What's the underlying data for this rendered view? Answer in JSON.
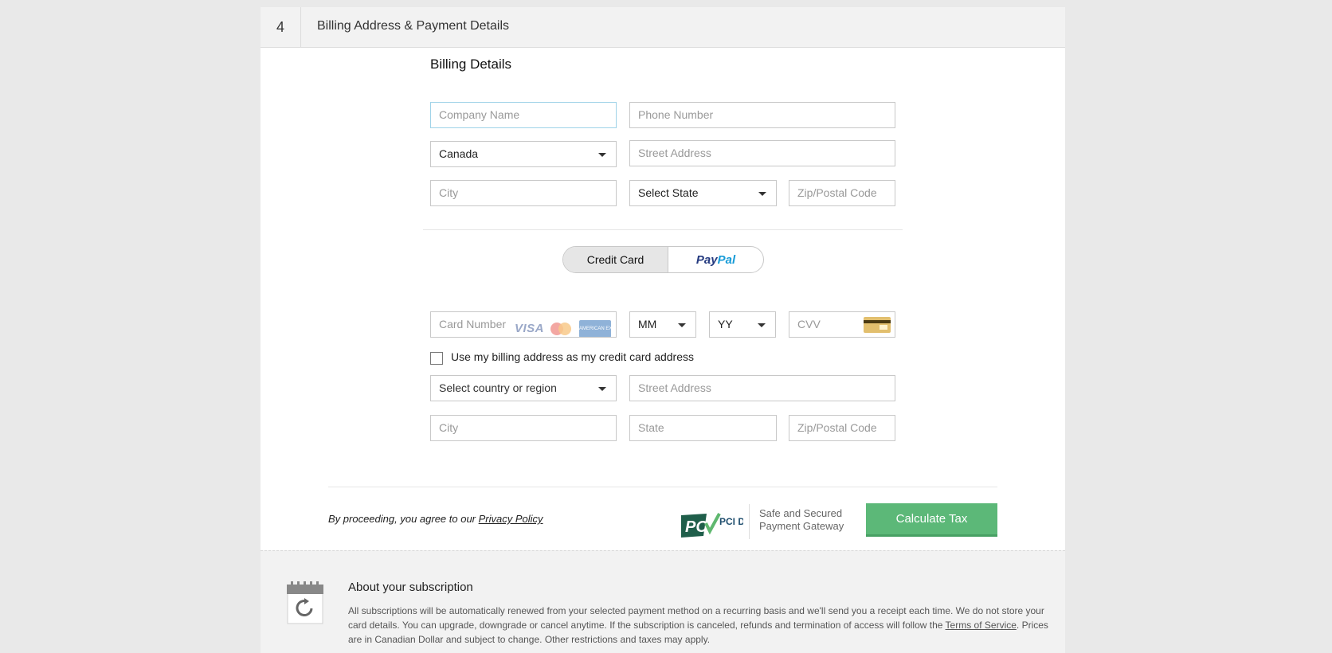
{
  "step": {
    "number": "4",
    "title": "Billing Address & Payment Details"
  },
  "billing": {
    "title": "Billing Details",
    "company_placeholder": "Company Name",
    "phone_placeholder": "Phone Number",
    "country_value": "Canada",
    "street_placeholder": "Street Address",
    "city_placeholder": "City",
    "state_value": "Select State",
    "zip_placeholder": "Zip/Postal Code"
  },
  "payment_toggle": {
    "credit_card_label": "Credit Card",
    "paypal_label_a": "Pay",
    "paypal_label_b": "Pal"
  },
  "card": {
    "number_placeholder": "Card Number",
    "visa_label": "VISA",
    "amex_label": "AMERICAN EXPRESS",
    "month_value": "MM",
    "year_value": "YY",
    "cvv_placeholder": "CVV",
    "use_billing_label": "Use my billing address as my credit card address"
  },
  "card_address": {
    "country_value": "Select country or region",
    "street_placeholder": "Street Address",
    "city_placeholder": "City",
    "state_placeholder": "State",
    "zip_placeholder": "Zip/Postal Code"
  },
  "footer": {
    "agree_prefix": "By proceeding, you agree to our ",
    "privacy_link": "Privacy Policy",
    "pci_label": "PCI DSS",
    "secure_line1": "Safe and Secured",
    "secure_line2": "Payment Gateway",
    "calculate_button": "Calculate Tax"
  },
  "about": {
    "title": "About your subscription",
    "text_before_link": "All subscriptions will be automatically renewed from your selected payment method on a recurring basis and we'll send you a receipt each time. We do not store your card details. You can upgrade, downgrade or cancel anytime. If the subscription is canceled, refunds and termination of access will follow the ",
    "tos_link": "Terms of Service",
    "text_after_link": ". Prices are in Canadian Dollar and subject to change. Other restrictions and taxes may apply."
  },
  "colors": {
    "primary_button": "#5cb878",
    "focus_border": "#9fd3e8",
    "paypal_dark": "#253b80",
    "paypal_light": "#179bd7"
  }
}
